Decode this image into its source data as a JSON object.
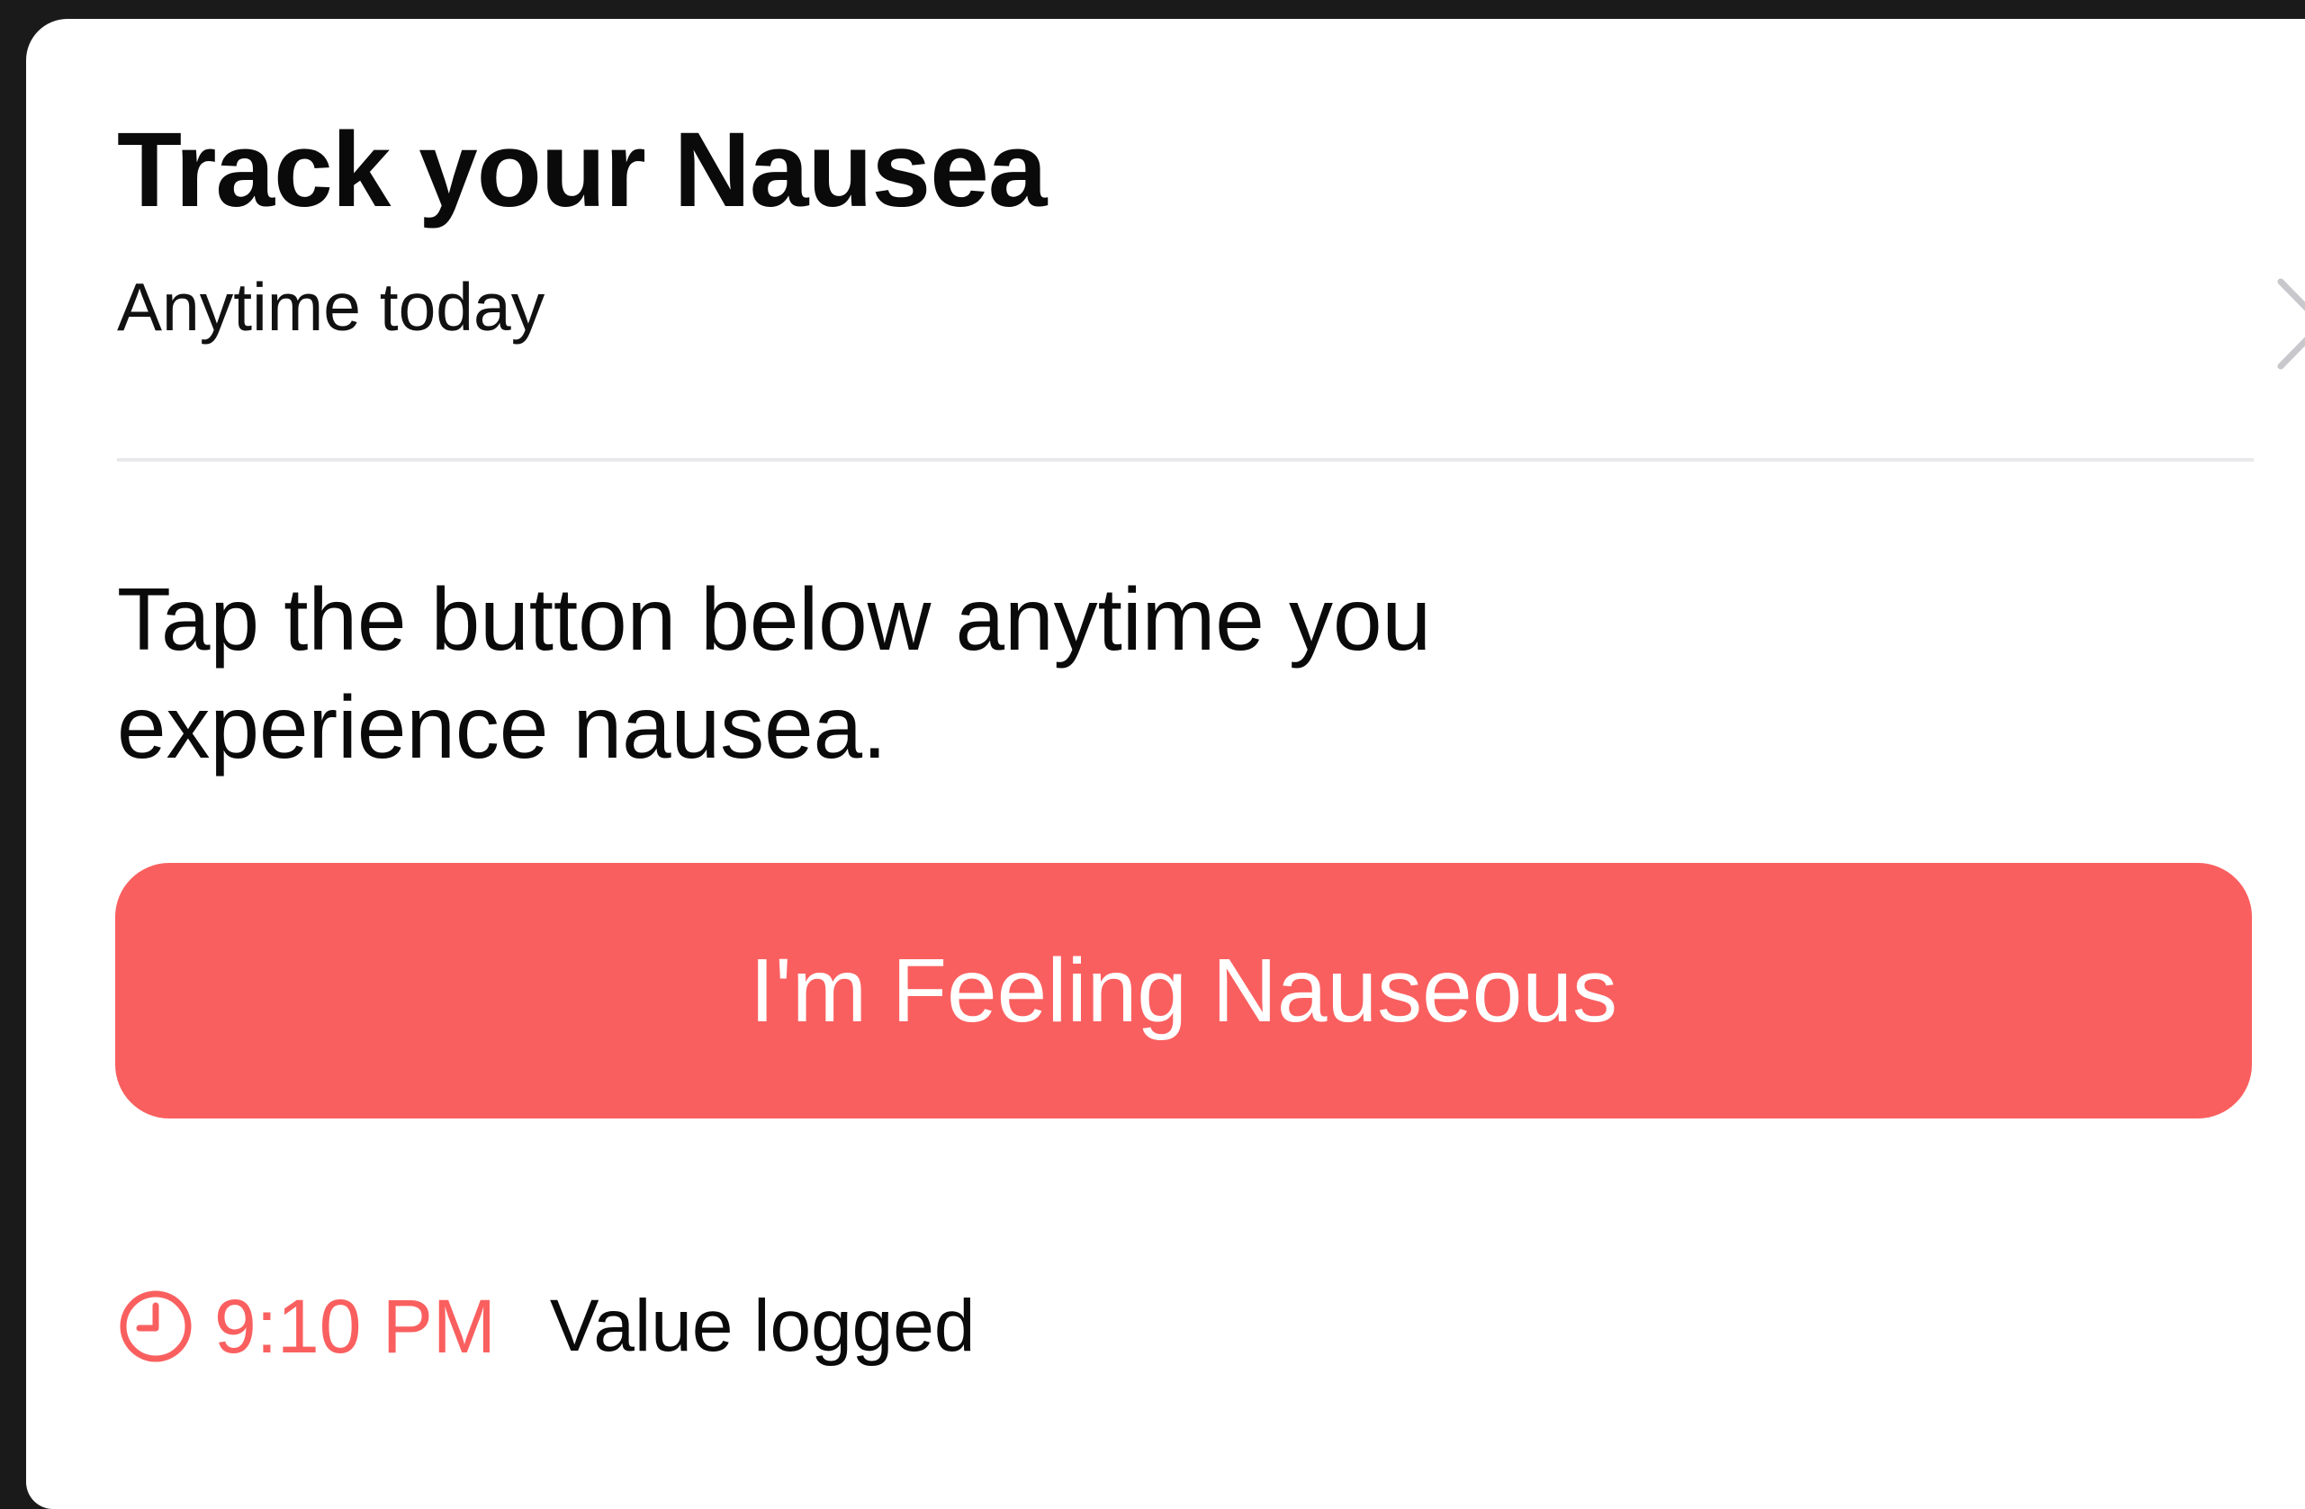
{
  "card": {
    "title": "Track your Nausea",
    "subtitle": "Anytime today",
    "instructions": "Tap the button below anytime you experience nausea.",
    "button_label": "I'm Feeling Nauseous",
    "log": {
      "time": "9:10 PM",
      "status": "Value logged"
    }
  },
  "icons": {
    "chevron": "chevron-right-icon",
    "clock": "clock-icon"
  },
  "colors": {
    "accent": "#fa5f5f",
    "background": "#1a1a1a",
    "card": "#ffffff",
    "divider": "#e9e9ec",
    "chevron": "#c7c7cc"
  }
}
